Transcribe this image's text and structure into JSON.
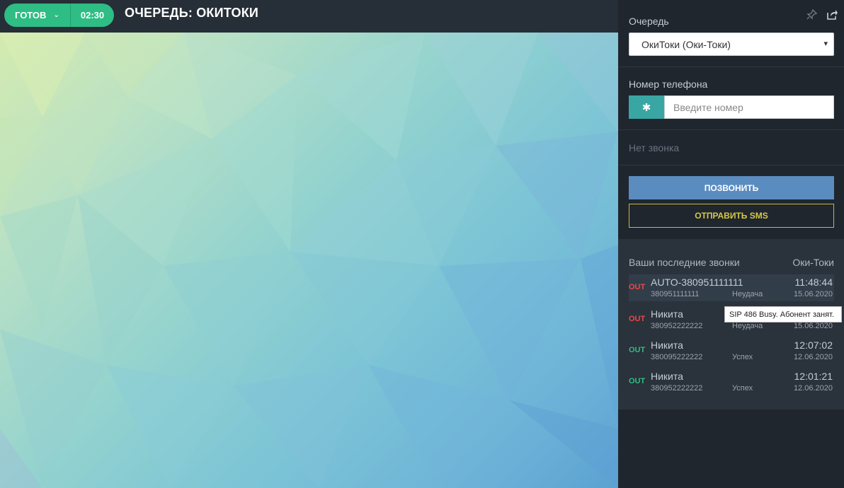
{
  "header": {
    "status_label": "ГОТОВ",
    "timer": "02:30",
    "title": "ОЧЕРЕДЬ: ОКИТОКИ"
  },
  "panel": {
    "queue_label": "Очередь",
    "queue_selected": "ОкиТоки (Оки-Токи)",
    "phone_label": "Номер телефона",
    "phone_placeholder": "Введите номер",
    "phone_button_glyph": "✱",
    "no_call": "Нет звонка",
    "call_button": "ПОЗВОНИТЬ",
    "sms_button": "ОТПРАВИТЬ SMS",
    "icons": [
      "pin-icon",
      "share-icon"
    ]
  },
  "recent": {
    "heading": "Ваши последние звонки",
    "queue": "Оки-Токи",
    "calls": [
      {
        "dir": "OUT",
        "status": "fail",
        "name": "AUTO-380951111111",
        "number": "380951111111",
        "result": "Неудача",
        "time": "11:48:44",
        "date": "15.06.2020"
      },
      {
        "dir": "OUT",
        "status": "fail",
        "name": "Никита",
        "number": "380952222222",
        "result": "Неудача",
        "time": "",
        "date": "15.06.2020"
      },
      {
        "dir": "OUT",
        "status": "ok",
        "name": "Никита",
        "number": "380095222222",
        "result": "Успех",
        "time": "12:07:02",
        "date": "12.06.2020"
      },
      {
        "dir": "OUT",
        "status": "ok",
        "name": "Никита",
        "number": "380952222222",
        "result": "Успех",
        "time": "12:01:21",
        "date": "12.06.2020"
      }
    ]
  },
  "tooltip": "SIP 486 Busy. Абонент занят.",
  "colors": {
    "ready": "#2ebd84",
    "call_button": "#5b8cc0",
    "sms_border": "#c8b83c",
    "fail": "#e84a4a",
    "success": "#2ebd84"
  }
}
